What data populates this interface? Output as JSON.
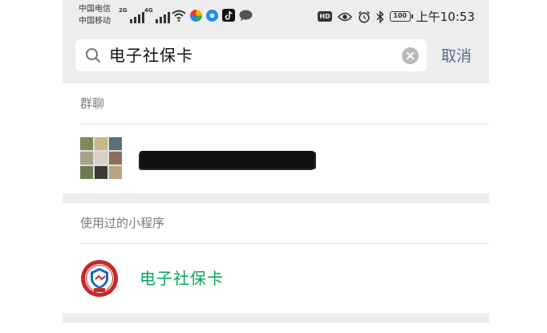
{
  "status_bar": {
    "carrier1": "中国电信",
    "carrier2": "中国移动",
    "sig1_tag": "2G",
    "sig2_tag": "4G",
    "hd_label": "HD",
    "battery": "100",
    "time": "上午10:53"
  },
  "search": {
    "query": "电子社保卡",
    "cancel_label": "取消"
  },
  "sections": {
    "group_chat": {
      "title": "群聊"
    },
    "mini_programs": {
      "title": "使用过的小程序",
      "items": [
        {
          "name": "电子社保卡"
        }
      ]
    }
  },
  "colors": {
    "background": "#ededed",
    "mini_program_name": "#07a65a",
    "cancel_link": "#576b95"
  }
}
